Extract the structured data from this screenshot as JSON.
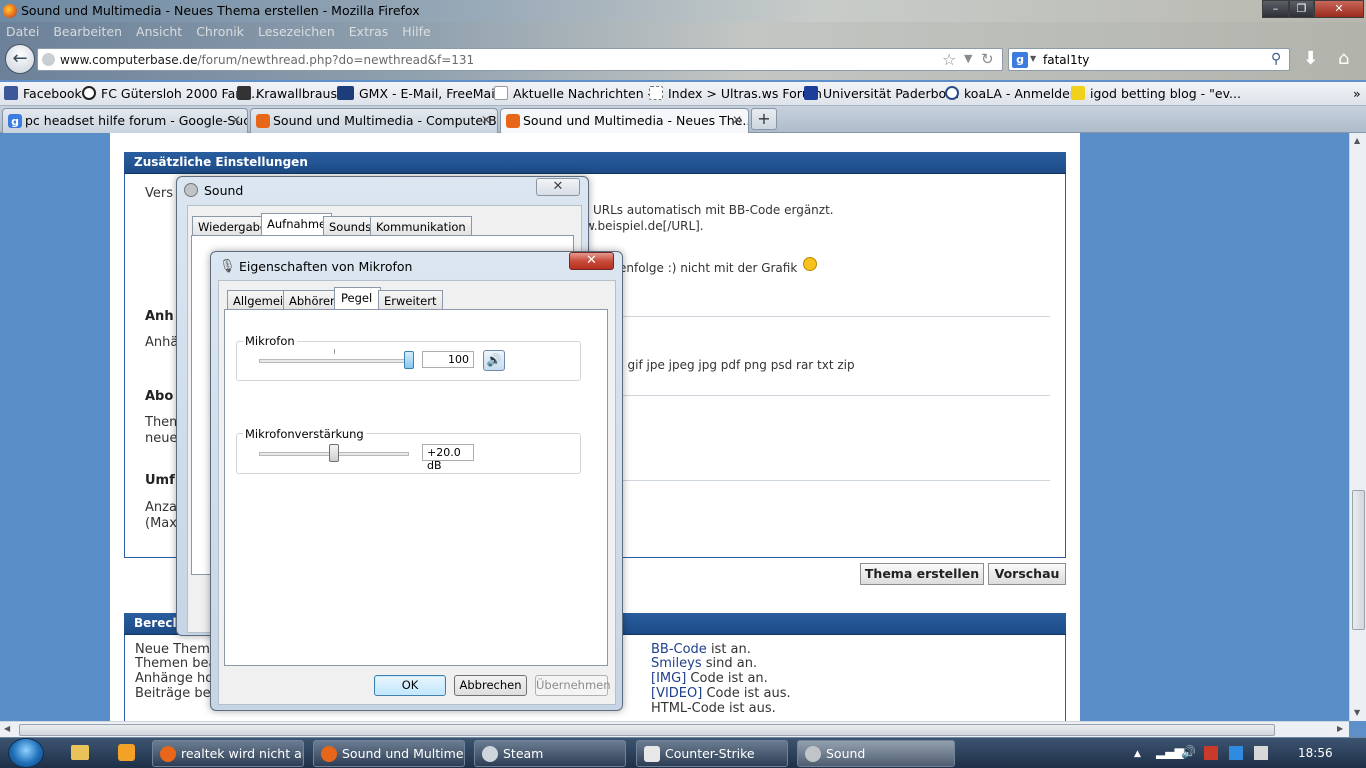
{
  "window": {
    "title": "Sound und Multimedia - Neues Thema erstellen - Mozilla Firefox",
    "controls": [
      "minimize",
      "restore",
      "close"
    ]
  },
  "menubar": [
    "Datei",
    "Bearbeiten",
    "Ansicht",
    "Chronik",
    "Lesezeichen",
    "Extras",
    "Hilfe"
  ],
  "urlbar": {
    "domain": "www.computerbase.de",
    "path": "/forum/newthread.php?do=newthread&f=131"
  },
  "searchbar": {
    "value": "fatal1ty"
  },
  "bookmarks": [
    {
      "label": "Facebook",
      "color": "#3b5998"
    },
    {
      "label": "FC Gütersloh 2000 Fan ...",
      "color": "#222222"
    },
    {
      "label": "Krawallbrause",
      "color": "#333333"
    },
    {
      "label": "GMX - E-Mail, FreeMai...",
      "color": "#1c3d7a"
    },
    {
      "label": "Aktuelle Nachrichten -...",
      "color": "#ffffff"
    },
    {
      "label": "Index > Ultras.ws Forum",
      "color": "#ffffff"
    },
    {
      "label": "Universität Paderborn",
      "color": "#1c3d9a"
    },
    {
      "label": "koaLA - Anmelden",
      "color": "#2a4e86"
    },
    {
      "label": "igod betting blog - \"ev...",
      "color": "#f0d11c"
    }
  ],
  "bookmarks_overflow": "»",
  "tabs": [
    {
      "label": "pc headset hilfe forum - Google-Suche",
      "active": false
    },
    {
      "label": "Sound und Multimedia - ComputerB...",
      "active": false
    },
    {
      "label": "Sound und Multimedia - Neues The...",
      "active": true
    }
  ],
  "new_tab": "+",
  "page": {
    "settings_header": "Zusätzliche Einstellungen",
    "frag_vers": "Vers",
    "frag_url1": "URLs automatisch mit BB-Code ergänzt.",
    "frag_url2": "w.beispiel.de[/URL].",
    "frag_smiley": "enfolge :) nicht mit der Grafik",
    "frag_anh_head": "Anh",
    "frag_anh": "Anhä",
    "frag_filetypes": "( gif jpe jpeg jpg pdf png psd rar txt zip",
    "frag_abo_head": "Abo",
    "frag_them": "Them",
    "frag_neue": "neue",
    "frag_umf_head": "Umf",
    "frag_anza": "Anza",
    "frag_max": "(Max",
    "btn_create": "Thema erstellen",
    "btn_preview": "Vorschau",
    "perm_header": "Berecl",
    "perm_left": [
      "Neue Theme",
      "Themen bea",
      "Anhänge ho",
      "Beiträge be"
    ],
    "perm_right": [
      {
        "link": "BB-Code",
        "text": " ist an."
      },
      {
        "link": "Smileys",
        "text": " sind an."
      },
      {
        "link": "[IMG]",
        "text": " Code ist an."
      },
      {
        "link": "[VIDEO]",
        "text": " Code ist aus."
      },
      {
        "link": "",
        "text": "HTML-Code ist aus."
      }
    ]
  },
  "sound_dialog": {
    "title": "Sound",
    "tabs": [
      "Wiedergabe",
      "Aufnahme",
      "Sounds",
      "Kommunikation"
    ],
    "active_tab": "Aufnahme"
  },
  "mic_dialog": {
    "title": "Eigenschaften von Mikrofon",
    "tabs": [
      "Allgemein",
      "Abhören",
      "Pegel",
      "Erweitert"
    ],
    "active_tab": "Pegel",
    "mic_label": "Mikrofon",
    "mic_value": "100",
    "mic_level_fraction": 1.0,
    "boost_label": "Mikrofonverstärkung",
    "boost_value": "+20.0 dB",
    "boost_level_fraction": 0.5,
    "btn_ok": "OK",
    "btn_cancel": "Abbrechen",
    "btn_apply": "Übernehmen"
  },
  "taskbar": {
    "items": [
      {
        "label": "realtek wird nicht an..."
      },
      {
        "label": "Sound und Multime..."
      },
      {
        "label": "Steam"
      },
      {
        "label": "Counter-Strike"
      },
      {
        "label": "Sound"
      }
    ],
    "clock": "18:56"
  }
}
